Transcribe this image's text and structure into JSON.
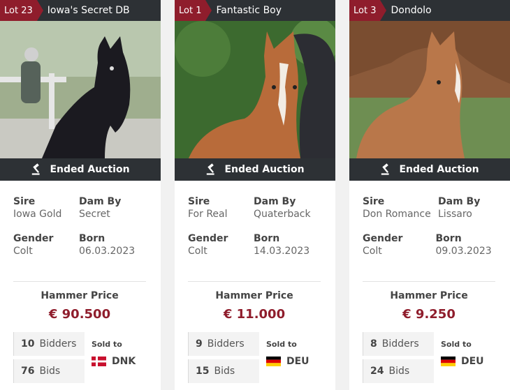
{
  "status_label": "Ended Auction",
  "labels": {
    "sire": "Sire",
    "dam_by": "Dam By",
    "gender": "Gender",
    "born": "Born",
    "hammer_price": "Hammer Price",
    "bidders": "Bidders",
    "bids": "Bids",
    "sold_to": "Sold to"
  },
  "colors": {
    "accent": "#8f1d2c",
    "bar": "#2d3135"
  },
  "lots": [
    {
      "lot": "Lot 23",
      "name": "Iowa's Secret DB",
      "sire": "Iowa Gold",
      "dam_by": "Secret",
      "gender": "Colt",
      "born": "06.03.2023",
      "price": "€ 90.500",
      "bidders": "10",
      "bids": "76",
      "country": "DNK",
      "flag": "denmark-flag"
    },
    {
      "lot": "Lot 1",
      "name": "Fantastic Boy",
      "sire": "For Real",
      "dam_by": "Quaterback",
      "gender": "Colt",
      "born": "14.03.2023",
      "price": "€ 11.000",
      "bidders": "9",
      "bids": "15",
      "country": "DEU",
      "flag": "germany-flag"
    },
    {
      "lot": "Lot 3",
      "name": "Dondolo",
      "sire": "Don Romance",
      "dam_by": "Lissaro",
      "gender": "Colt",
      "born": "09.03.2023",
      "price": "€ 9.250",
      "bidders": "8",
      "bids": "24",
      "country": "DEU",
      "flag": "germany-flag"
    }
  ]
}
